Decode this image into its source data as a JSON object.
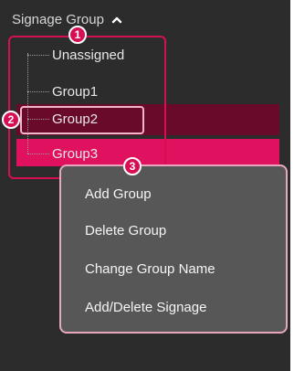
{
  "header": {
    "title": "Signage Group",
    "toggle_icon": "chevron-up-icon"
  },
  "tree": {
    "items": [
      {
        "label": "Unassigned"
      },
      {
        "label": "Group1"
      },
      {
        "label": "Group2",
        "state": "selected"
      },
      {
        "label": "Group3",
        "state": "hover"
      }
    ]
  },
  "context_menu": {
    "items": [
      {
        "label": "Add Group"
      },
      {
        "label": "Delete Group"
      },
      {
        "label": "Change Group Name"
      },
      {
        "label": "Add/Delete Signage"
      }
    ]
  },
  "callouts": [
    "1",
    "2",
    "3"
  ],
  "colors": {
    "panel_bg": "#2c2c2c",
    "accent": "#d60f55",
    "selected_row": "#6a0a2b",
    "hover_row": "#e0115f",
    "menu_bg": "#575757"
  }
}
